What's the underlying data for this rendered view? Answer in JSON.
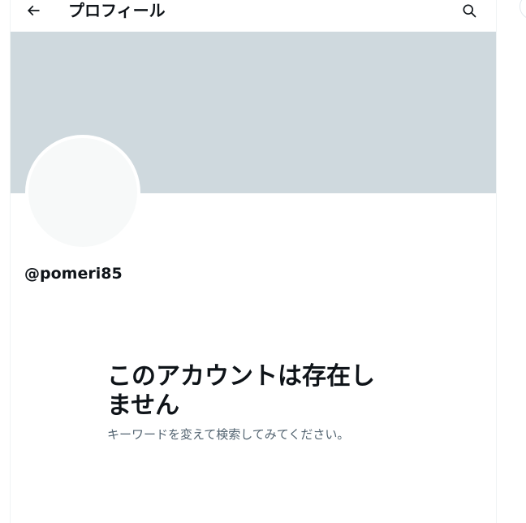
{
  "header": {
    "title": "プロフィール",
    "back_icon": "arrow-left-icon",
    "search_icon": "search-icon"
  },
  "profile": {
    "handle": "@pomeri85"
  },
  "empty_state": {
    "title": "このアカウントは存在しません",
    "subtitle": "キーワードを変えて検索してみてください。"
  },
  "colors": {
    "banner": "#cfd9de",
    "avatar": "#f7f9f9",
    "text_primary": "#0f1419",
    "text_secondary": "#536471"
  }
}
